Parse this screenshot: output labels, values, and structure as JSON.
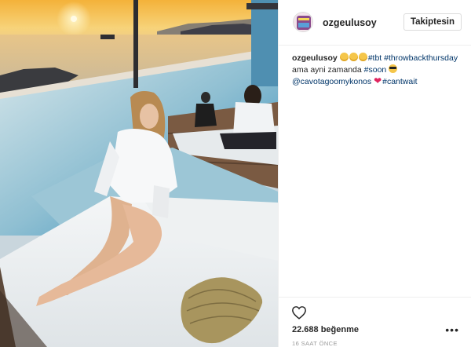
{
  "post": {
    "image_alt": "Woman in white shirt sitting on a white sunbed by an infinity pool at sunset"
  },
  "header": {
    "username": "ozgeulusoy",
    "follow_label": "Takiptesin"
  },
  "caption": {
    "username": "ozgeulusoy",
    "hashtag_tbt": "#tbt",
    "hashtag_throwback": "#throwbackthursday",
    "text_line2": "ama ayni zamanda",
    "hashtag_soon": "#soon",
    "mention": "@cavotagoomykonos",
    "hashtag_cantwait": "#cantwait"
  },
  "footer": {
    "likes": "22.688 beğenme",
    "more_label": "•••",
    "time": "16 SAAT ÖNCE"
  },
  "icons": {
    "like": "heart-outline-icon",
    "more": "more-options-icon"
  },
  "colors": {
    "link": "#003569",
    "text": "#262626",
    "muted": "#999999",
    "border": "#efefef"
  }
}
